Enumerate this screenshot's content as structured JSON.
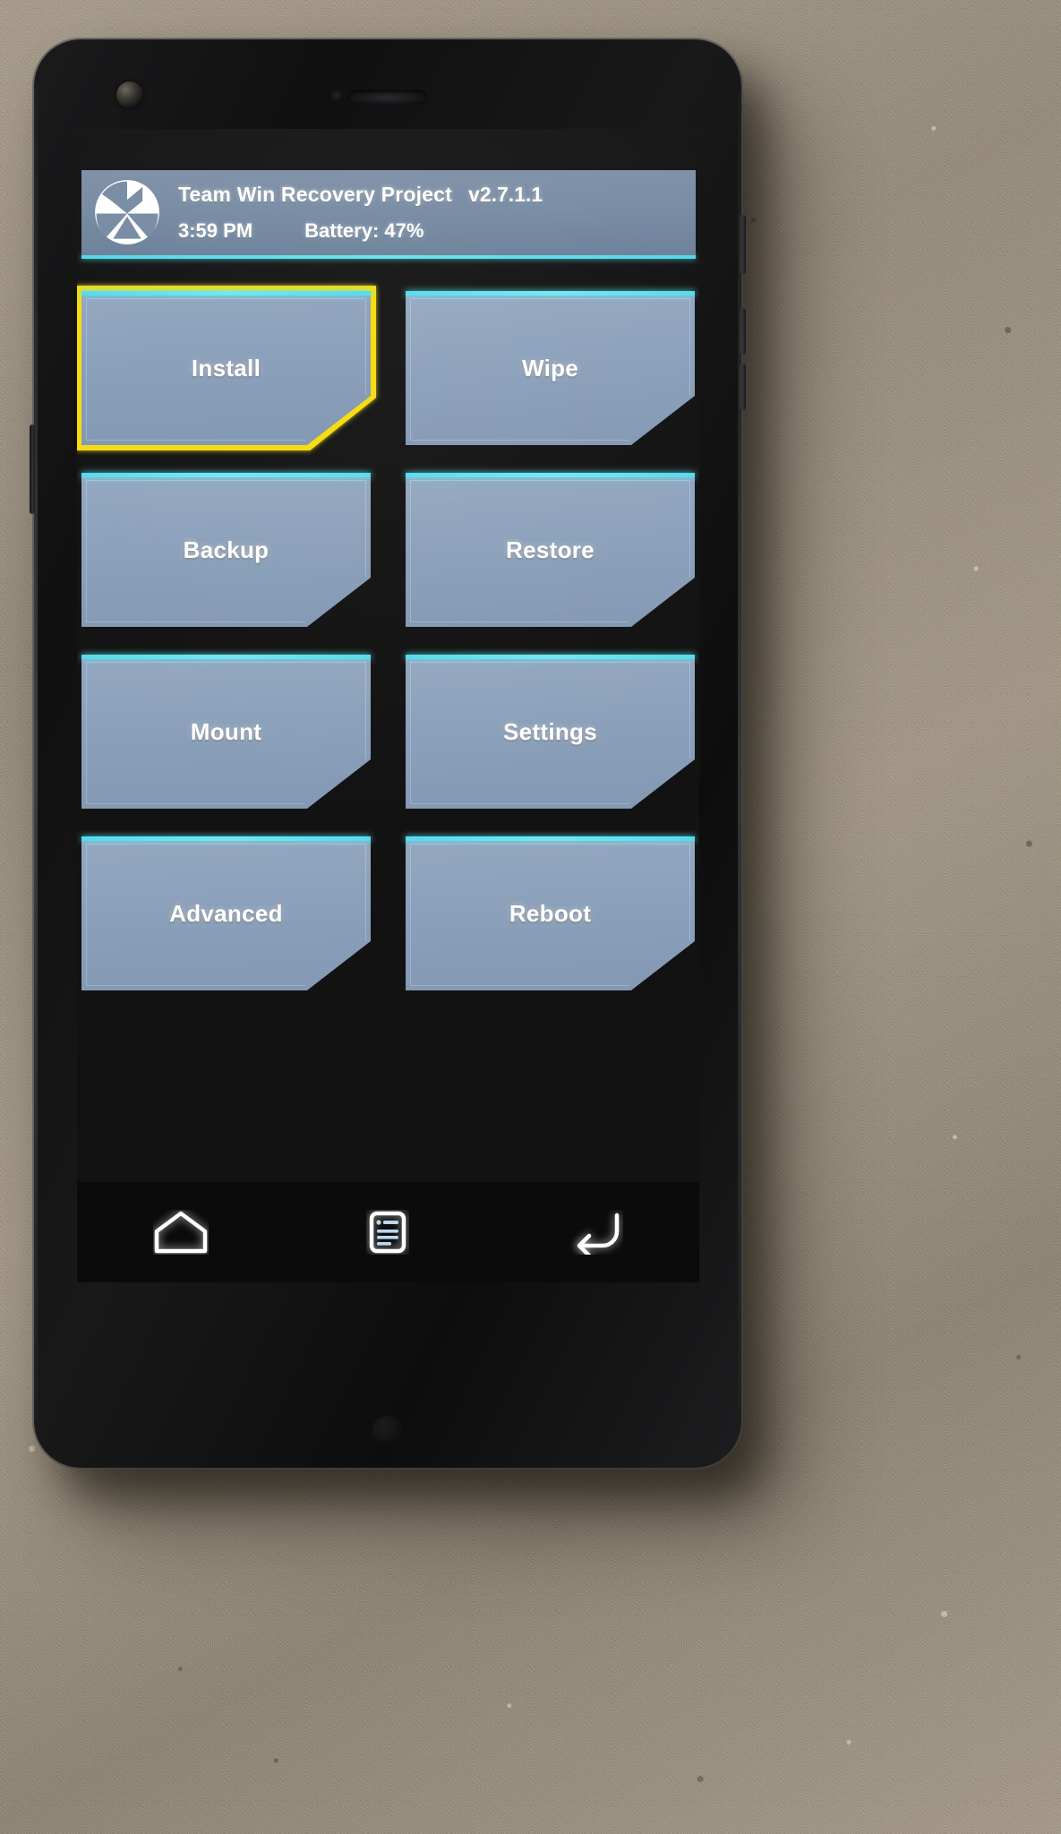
{
  "app": {
    "title": "Team Win Recovery Project",
    "version": "v2.7.1.1",
    "clock": "3:59 PM",
    "battery": "Battery: 47%",
    "logo_icon": "twrp-logo-icon"
  },
  "colors": {
    "header_bg": "#768ba3",
    "accent_cyan": "#54dced",
    "tile_face": "#8ba0ba",
    "selection_yellow": "#f5dc14",
    "screen_bg": "#121212",
    "text": "#ffffff"
  },
  "menu": {
    "selected_index": 0,
    "tiles": [
      {
        "label": "Install",
        "name": "install"
      },
      {
        "label": "Wipe",
        "name": "wipe"
      },
      {
        "label": "Backup",
        "name": "backup"
      },
      {
        "label": "Restore",
        "name": "restore"
      },
      {
        "label": "Mount",
        "name": "mount"
      },
      {
        "label": "Settings",
        "name": "settings"
      },
      {
        "label": "Advanced",
        "name": "advanced"
      },
      {
        "label": "Reboot",
        "name": "reboot"
      }
    ]
  },
  "navbar": {
    "buttons": [
      {
        "name": "home-icon",
        "label": "Home"
      },
      {
        "name": "recents-icon",
        "label": "Recent apps"
      },
      {
        "name": "back-icon",
        "label": "Back"
      }
    ]
  }
}
